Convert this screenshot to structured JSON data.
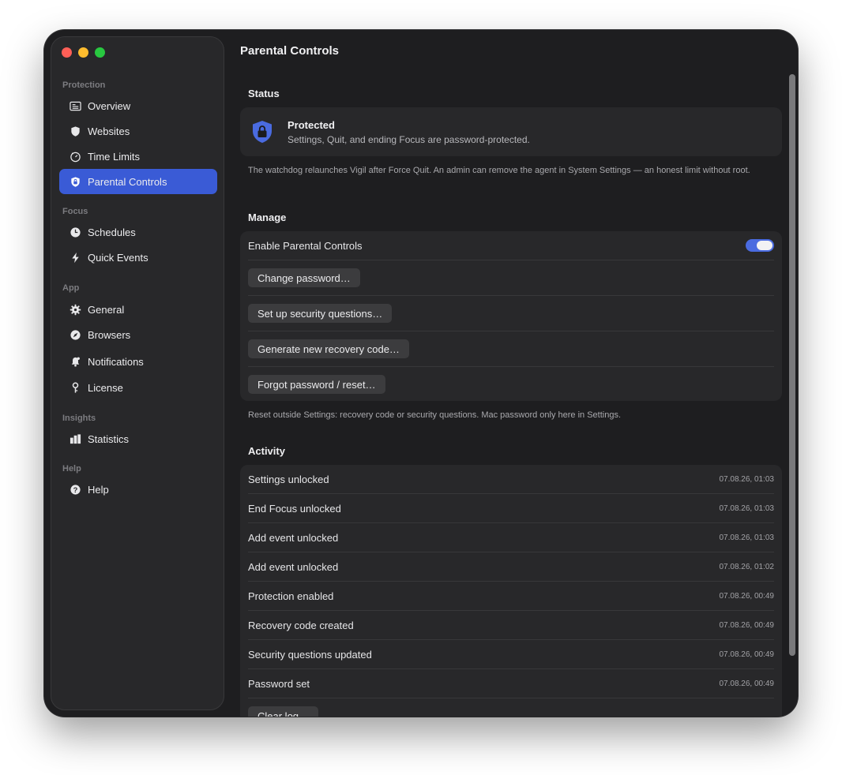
{
  "sidebar": {
    "sections": {
      "protection": "Protection",
      "focus": "Focus",
      "app": "App",
      "insights": "Insights",
      "help": "Help"
    },
    "items": {
      "overview": "Overview",
      "websites": "Websites",
      "time_limits": "Time Limits",
      "parental_controls": "Parental Controls",
      "schedules": "Schedules",
      "quick_events": "Quick Events",
      "general": "General",
      "browsers": "Browsers",
      "notifications": "Notifications",
      "license": "License",
      "statistics": "Statistics",
      "help": "Help"
    },
    "active_item": "parental_controls",
    "accent_color": "#3a5bd6"
  },
  "page": {
    "title": "Parental Controls"
  },
  "status": {
    "heading": "Status",
    "title": "Protected",
    "subtitle": "Settings, Quit, and ending Focus are password-protected.",
    "note": "The watchdog relaunches Vigil after Force Quit. An admin can remove the agent in System Settings — an honest limit without root.",
    "icon": "lock-shield-icon"
  },
  "manage": {
    "heading": "Manage",
    "enable_label": "Enable Parental Controls",
    "enabled": true,
    "change_password": "Change password…",
    "security_questions": "Set up security questions…",
    "recovery_code": "Generate new recovery code…",
    "forgot_password": "Forgot password / reset…",
    "note": "Reset outside Settings: recovery code or security questions. Mac password only here in Settings."
  },
  "activity": {
    "heading": "Activity",
    "rows": [
      {
        "label": "Settings unlocked",
        "time": "07.08.26, 01:03"
      },
      {
        "label": "End Focus unlocked",
        "time": "07.08.26, 01:03"
      },
      {
        "label": "Add event unlocked",
        "time": "07.08.26, 01:03"
      },
      {
        "label": "Add event unlocked",
        "time": "07.08.26, 01:02"
      },
      {
        "label": "Protection enabled",
        "time": "07.08.26, 00:49"
      },
      {
        "label": "Recovery code created",
        "time": "07.08.26, 00:49"
      },
      {
        "label": "Security questions updated",
        "time": "07.08.26, 00:49"
      },
      {
        "label": "Password set",
        "time": "07.08.26, 00:49"
      }
    ],
    "clear_log": "Clear log…"
  }
}
